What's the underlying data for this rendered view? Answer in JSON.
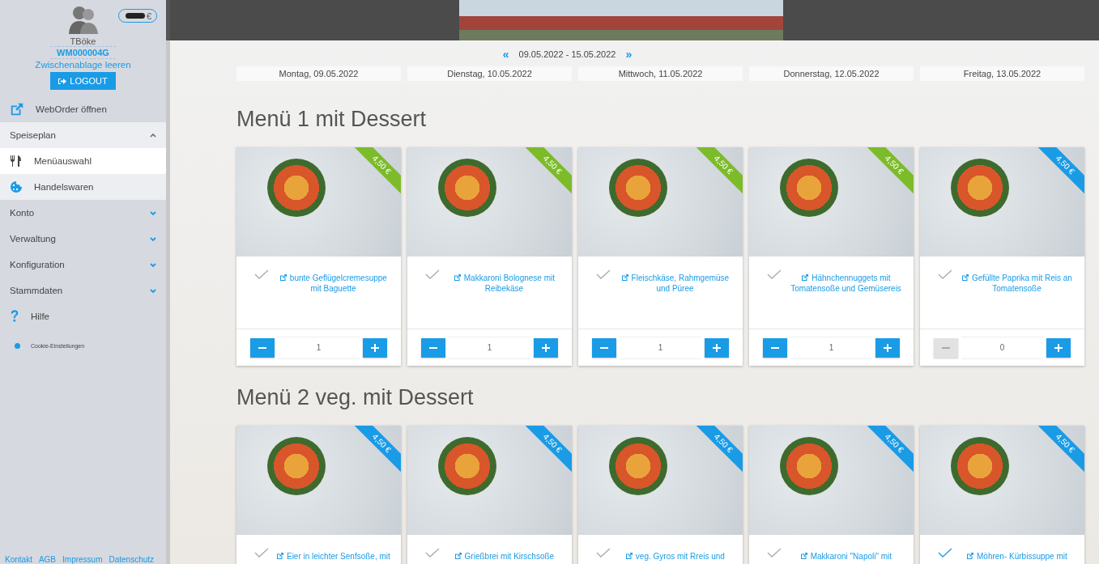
{
  "sidebar": {
    "user": {
      "name": "TBöke",
      "customer_number": "WM000004G",
      "clear_clipboard": "Zwischenablage leeren",
      "logout": "LOGOUT",
      "balance_currency": "€"
    },
    "items": [
      {
        "kind": "link",
        "label": "WebOrder öffnen"
      },
      {
        "kind": "section",
        "label": "Speiseplan",
        "expanded": true,
        "children": [
          {
            "label": "Menüauswahl",
            "selected": true
          },
          {
            "label": "Handelswaren",
            "selected": false
          }
        ]
      },
      {
        "kind": "section",
        "label": "Konto",
        "expanded": false
      },
      {
        "kind": "section",
        "label": "Verwaltung",
        "expanded": false
      },
      {
        "kind": "section",
        "label": "Konfiguration",
        "expanded": false
      },
      {
        "kind": "section",
        "label": "Stammdaten",
        "expanded": false
      },
      {
        "kind": "link",
        "label": "Hilfe"
      },
      {
        "kind": "small",
        "label": "Cookie-Einstellungen"
      }
    ],
    "footer_links": [
      "Kontakt",
      "AGB",
      "Impressum",
      "Datenschutz"
    ]
  },
  "week_nav": {
    "prev": "«",
    "range": "09.05.2022 - 15.05.2022",
    "next": "»"
  },
  "days": [
    "Montag, 09.05.2022",
    "Dienstag, 10.05.2022",
    "Mittwoch, 11.05.2022",
    "Donnerstag, 12.05.2022",
    "Freitag, 13.05.2022"
  ],
  "menus": [
    {
      "title": "Menü 1 mit Dessert",
      "dishes": [
        {
          "name": "bunte Geflügelcremesuppe mit Baguette",
          "price": "4,50 €",
          "ordered": true,
          "checked": false,
          "quantity": "1",
          "decrease_disabled": false
        },
        {
          "name": "Makkaroni Bolognese mit Reibekäse",
          "price": "4,50 €",
          "ordered": true,
          "checked": false,
          "quantity": "1",
          "decrease_disabled": false
        },
        {
          "name": "Fleischkäse, Rahmgemüse und Püree",
          "price": "4,50 €",
          "ordered": true,
          "checked": false,
          "quantity": "1",
          "decrease_disabled": false
        },
        {
          "name": "Hähnchennuggets mit Tomatensoße und Gemüsereis",
          "price": "4,50 €",
          "ordered": true,
          "checked": false,
          "quantity": "1",
          "decrease_disabled": false
        },
        {
          "name": "Gefüllte Paprika mit Reis an Tomatensoße",
          "price": "4,50 €",
          "ordered": false,
          "checked": false,
          "quantity": "0",
          "decrease_disabled": true
        }
      ]
    },
    {
      "title": "Menü 2 veg. mit Dessert",
      "dishes": [
        {
          "name": "Eier in leichter Senfsoße, mit",
          "price": "4,50 €",
          "ordered": false,
          "checked": false
        },
        {
          "name": "Grießbrei mit Kirschsoße",
          "price": "4,50 €",
          "ordered": false,
          "checked": false
        },
        {
          "name": "veg. Gyros mit Rreis und",
          "price": "4,50 €",
          "ordered": false,
          "checked": false
        },
        {
          "name": "Makkaroni \"Napoli\" mit",
          "price": "4,50 €",
          "ordered": false,
          "checked": false
        },
        {
          "name": "Möhren- Kürbissuppe mit",
          "price": "4,50 €",
          "ordered": false,
          "checked": true
        }
      ]
    }
  ]
}
